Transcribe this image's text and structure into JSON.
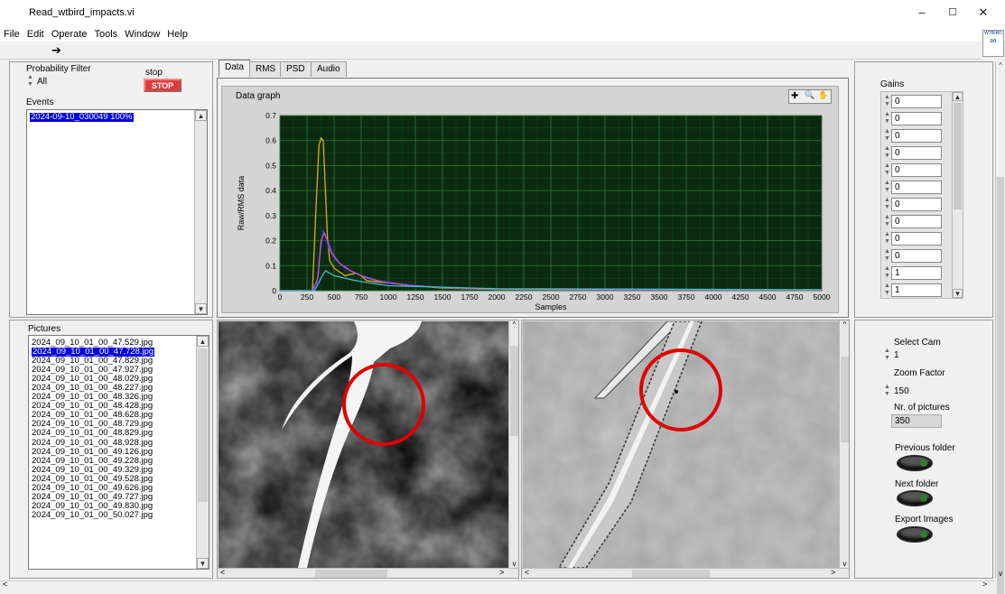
{
  "window": {
    "title": "Read_wtbird_impacts.vi",
    "min_glyph": "–",
    "max_glyph": "☐",
    "close_glyph": "✕"
  },
  "menu": [
    "File",
    "Edit",
    "Operate",
    "Tools",
    "Window",
    "Help"
  ],
  "toolbar": {
    "run_glyph": "➔"
  },
  "app_icon": {
    "text": "WTBIRD"
  },
  "probability_filter": {
    "label": "Probability Filter",
    "value": "All"
  },
  "stop": {
    "label": "stop",
    "button": "STOP"
  },
  "events": {
    "label": "Events",
    "items": [
      "2024-09-10_030049 100%"
    ],
    "selected": 0
  },
  "tabs": [
    {
      "label": "Data",
      "active": true
    },
    {
      "label": "RMS"
    },
    {
      "label": "PSD"
    },
    {
      "label": "Audio"
    }
  ],
  "graph": {
    "title": "Data graph",
    "tools": [
      "✚",
      "🔍",
      "✋"
    ]
  },
  "chart_data": {
    "type": "line",
    "title": "",
    "xlabel": "Samples",
    "ylabel": "Raw/RMS data",
    "xlim": [
      0,
      5000
    ],
    "ylim": [
      0,
      0.7
    ],
    "xticks": [
      0,
      250,
      500,
      750,
      1000,
      1250,
      1500,
      1750,
      2000,
      2250,
      2500,
      2750,
      3000,
      3250,
      3500,
      3750,
      4000,
      4250,
      4500,
      4750,
      5000
    ],
    "yticks": [
      0,
      0.1,
      0.2,
      0.3,
      0.4,
      0.5,
      0.6,
      0.7
    ],
    "grid": true,
    "series": [
      {
        "color": "#e0b000",
        "x": [
          0,
          300,
          330,
          360,
          380,
          400,
          420,
          440,
          460,
          500,
          600,
          700,
          750,
          800,
          1000,
          1500,
          2000,
          3000,
          5000
        ],
        "y": [
          0,
          0,
          0.3,
          0.58,
          0.61,
          0.6,
          0.4,
          0.2,
          0.12,
          0.09,
          0.06,
          0.07,
          0.06,
          0.04,
          0.03,
          0.01,
          0.005,
          0.003,
          0.002
        ]
      },
      {
        "color": "#3a3af0",
        "x": [
          0,
          300,
          340,
          370,
          400,
          420,
          450,
          500,
          600,
          700,
          800,
          1000,
          1500,
          2000,
          3000,
          5000
        ],
        "y": [
          0,
          0,
          0.02,
          0.15,
          0.24,
          0.22,
          0.17,
          0.13,
          0.09,
          0.07,
          0.05,
          0.03,
          0.012,
          0.006,
          0.003,
          0.002
        ]
      },
      {
        "color": "#d050d0",
        "x": [
          0,
          300,
          350,
          380,
          410,
          440,
          480,
          550,
          650,
          750,
          900,
          1200,
          1800,
          2500,
          5000
        ],
        "y": [
          0,
          0,
          0.05,
          0.2,
          0.23,
          0.2,
          0.15,
          0.11,
          0.08,
          0.06,
          0.04,
          0.02,
          0.008,
          0.004,
          0.002
        ]
      },
      {
        "color": "#40c0c0",
        "x": [
          0,
          320,
          380,
          420,
          500,
          700,
          1000,
          2000,
          5000
        ],
        "y": [
          0,
          0,
          0.05,
          0.08,
          0.06,
          0.04,
          0.02,
          0.008,
          0.004
        ]
      }
    ]
  },
  "gains": {
    "label": "Gains",
    "values": [
      "0",
      "0",
      "0",
      "0",
      "0",
      "0",
      "0",
      "0",
      "0",
      "0",
      "1",
      "1"
    ]
  },
  "pictures": {
    "label": "Pictures",
    "selected": 1,
    "items": [
      "2024_09_10_01_00_47.529.jpg",
      "2024_09_10_01_00_47.728.jpg",
      "2024_09_10_01_00_47.829.jpg",
      "2024_09_10_01_00_47.927.jpg",
      "2024_09_10_01_00_48.029.jpg",
      "2024_09_10_01_00_48.227.jpg",
      "2024_09_10_01_00_48.326.jpg",
      "2024_09_10_01_00_48.428.jpg",
      "2024_09_10_01_00_48.628.jpg",
      "2024_09_10_01_00_48.729.jpg",
      "2024_09_10_01_00_48.829.jpg",
      "2024_09_10_01_00_48.928.jpg",
      "2024_09_10_01_00_49.126.jpg",
      "2024_09_10_01_00_49.228.jpg",
      "2024_09_10_01_00_49.329.jpg",
      "2024_09_10_01_00_49.528.jpg",
      "2024_09_10_01_00_49.626.jpg",
      "2024_09_10_01_00_49.727.jpg",
      "2024_09_10_01_00_49.830.jpg",
      "2024_09_10_01_00_50.027.jpg"
    ]
  },
  "select_cam": {
    "label": "Select Cam",
    "value": "1"
  },
  "zoom": {
    "label": "Zoom Factor",
    "value": "150"
  },
  "nr_pictures": {
    "label": "Nr. of pictures",
    "value": "350"
  },
  "buttons": {
    "previous": "Previous folder",
    "next": "Next folder",
    "export": "Export Images"
  },
  "colors": {
    "plot_bg": "#0b2a10",
    "grid": "#2f7a2f",
    "highlight_circle": "#e00000",
    "selection": "#0000e0"
  }
}
